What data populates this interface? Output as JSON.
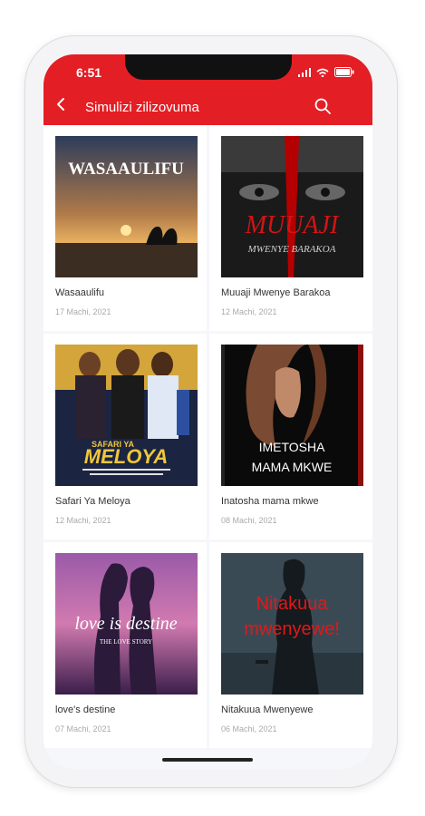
{
  "status": {
    "time": "6:51"
  },
  "header": {
    "title": "Simulizi zilizovuma"
  },
  "stories": [
    {
      "title": "Wasaaulifu",
      "date": "17 Machi, 2021",
      "cover_text": "WASAAULIFU"
    },
    {
      "title": "Muuaji Mwenye Barakoa",
      "date": "12 Machi, 2021",
      "cover_text": "MUUAJI",
      "cover_sub": "MWENYE BARAKOA"
    },
    {
      "title": "Safari Ya Meloya",
      "date": "12 Machi, 2021",
      "cover_text": "SAFARI YA",
      "cover_sub": "MELOYA"
    },
    {
      "title": "Inatosha mama mkwe",
      "date": "08 Machi, 2021",
      "cover_text": "IMETOSHA",
      "cover_sub": "MAMA MKWE"
    },
    {
      "title": "love's destine",
      "date": "07 Machi, 2021",
      "cover_text": "love is destine",
      "cover_sub": "THE LOVE STORY"
    },
    {
      "title": "Nitakuua Mwenyewe",
      "date": "06 Machi, 2021",
      "cover_text": "Nitakuua",
      "cover_sub": "mwenyewe!"
    }
  ],
  "colors": {
    "accent": "#e31e24"
  }
}
